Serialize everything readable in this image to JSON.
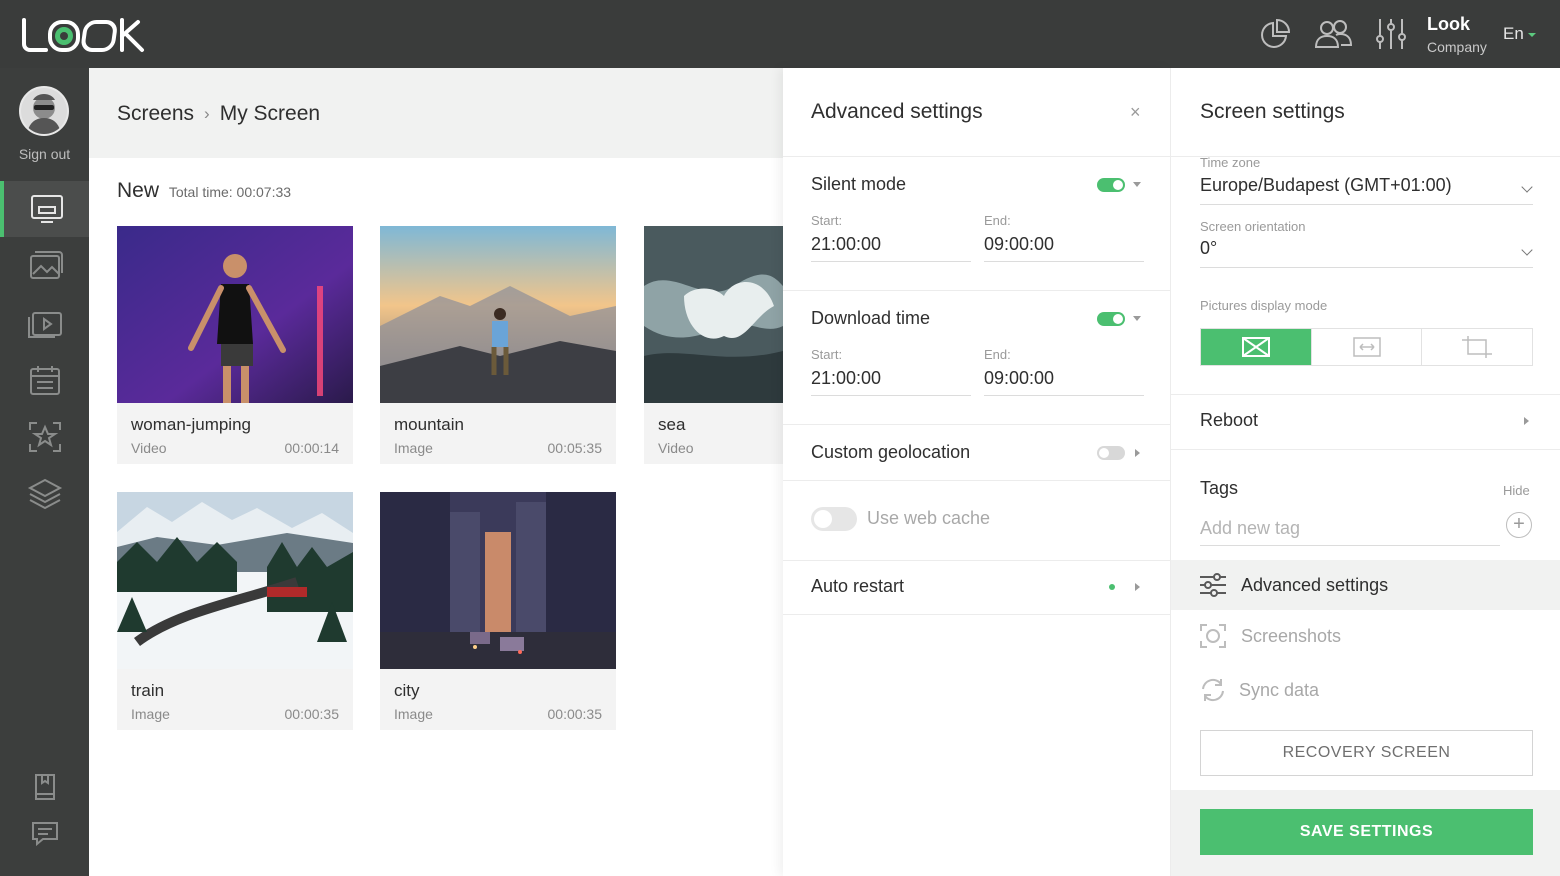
{
  "app": {
    "logo_text": "LOOK"
  },
  "header": {
    "user_name": "Look",
    "user_company": "Company",
    "language": "En",
    "icons": [
      "analytics-icon",
      "users-icon",
      "settings-sliders-icon"
    ]
  },
  "sidebar": {
    "sign_out": "Sign out",
    "items": [
      "screens-icon",
      "gallery-icon",
      "playlist-icon",
      "calendar-icon",
      "star-frame-icon",
      "layers-icon",
      "book-icon",
      "chat-icon"
    ]
  },
  "main": {
    "breadcrumb": [
      "Screens",
      "My Screen"
    ],
    "section_title": "New",
    "total_time": "Total time: 00:07:33",
    "cards": [
      {
        "name": "woman-jumping",
        "type": "Video",
        "duration": "00:00:14"
      },
      {
        "name": "mountain",
        "type": "Image",
        "duration": "00:05:35"
      },
      {
        "name": "sea",
        "type": "Video",
        "duration": ""
      },
      {
        "name": "train",
        "type": "Image",
        "duration": "00:00:35"
      },
      {
        "name": "city",
        "type": "Image",
        "duration": "00:00:35"
      }
    ]
  },
  "advanced": {
    "title": "Advanced settings",
    "close": "×",
    "silent_mode": {
      "label": "Silent mode",
      "start_label": "Start:",
      "start": "21:00:00",
      "end_label": "End:",
      "end": "09:00:00",
      "enabled": true
    },
    "download_time": {
      "label": "Download time",
      "start_label": "Start:",
      "start": "21:00:00",
      "end_label": "End:",
      "end": "09:00:00",
      "enabled": true
    },
    "custom_geolocation": {
      "label": "Custom geolocation",
      "enabled": false
    },
    "web_cache": {
      "label": "Use web cache",
      "enabled": false
    },
    "auto_restart": {
      "label": "Auto restart"
    }
  },
  "screen_settings": {
    "title": "Screen settings",
    "time_zone_label": "Time zone",
    "time_zone": "Europe/Budapest (GMT+01:00)",
    "orientation_label": "Screen orientation",
    "orientation": "0°",
    "display_mode_label": "Pictures display mode",
    "reboot": "Reboot",
    "tags_label": "Tags",
    "tags_hide": "Hide",
    "tags_placeholder": "Add new tag",
    "menu": [
      {
        "label": "Advanced settings",
        "icon": "sliders-icon"
      },
      {
        "label": "Screenshots",
        "icon": "screenshot-icon"
      },
      {
        "label": "Sync data",
        "icon": "sync-icon"
      }
    ],
    "recovery": "RECOVERY SCREEN",
    "save": "SAVE SETTINGS"
  },
  "colors": {
    "accent": "#4bbf70",
    "topbar": "#3a3c3b",
    "sidebar": "#3c3e3d"
  }
}
